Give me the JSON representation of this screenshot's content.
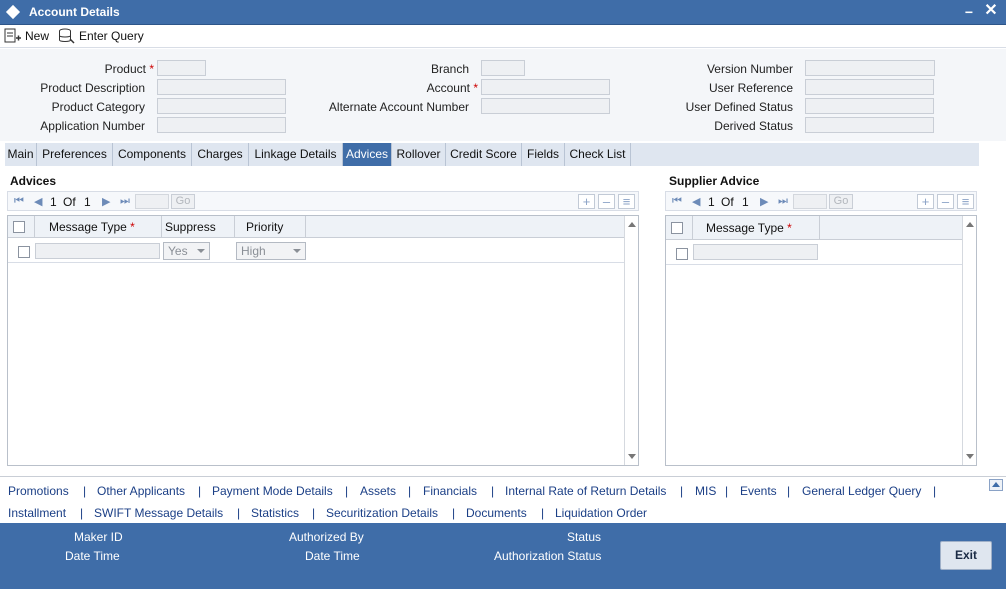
{
  "window": {
    "title": "Account Details"
  },
  "toolbar": {
    "new_label": "New",
    "enter_query_label": "Enter Query"
  },
  "form": {
    "product_label": "Product",
    "product_description_label": "Product Description",
    "product_category_label": "Product Category",
    "application_number_label": "Application Number",
    "branch_label": "Branch",
    "account_label": "Account",
    "alternate_account_label": "Alternate Account Number",
    "version_number_label": "Version Number",
    "user_reference_label": "User Reference",
    "user_defined_status_label": "User Defined Status",
    "derived_status_label": "Derived Status",
    "required_mark": "*"
  },
  "tabs": [
    "Main",
    "Preferences",
    "Components",
    "Charges",
    "Linkage Details",
    "Advices",
    "Rollover",
    "Credit Score",
    "Fields",
    "Check List"
  ],
  "active_tab": "Advices",
  "advices": {
    "title": "Advices",
    "page_current": "1",
    "page_of": "Of",
    "page_total": "1",
    "go_label": "Go",
    "columns": [
      "Message Type",
      "Suppress",
      "Priority"
    ],
    "row": {
      "message_type": "",
      "suppress": "Yes",
      "priority": "High"
    }
  },
  "supplier_advice": {
    "title": "Supplier Advice",
    "page_current": "1",
    "page_of": "Of",
    "page_total": "1",
    "go_label": "Go",
    "columns": [
      "Message Type"
    ]
  },
  "links_row1": [
    "Promotions",
    "Other Applicants",
    "Payment Mode Details",
    "Assets",
    "Financials",
    "Internal Rate of Return Details",
    "MIS",
    "Events",
    "General Ledger Query"
  ],
  "links_row2": [
    "Installment",
    "SWIFT Message Details",
    "Statistics",
    "Securitization Details",
    "Documents",
    "Liquidation Order"
  ],
  "link_separator": "|",
  "footer": {
    "maker_id_label": "Maker ID",
    "date_time_label_1": "Date Time",
    "authorized_by_label": "Authorized By",
    "date_time_label_2": "Date Time",
    "status_label": "Status",
    "authorization_status_label": "Authorization Status",
    "exit_label": "Exit"
  },
  "colors": {
    "header_blue": "#3f6da8",
    "link_blue": "#1b3f86",
    "required_red": "#cc0000"
  }
}
